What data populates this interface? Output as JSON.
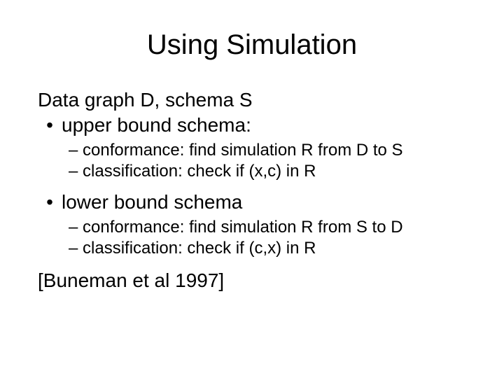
{
  "title": "Using Simulation",
  "intro": "Data graph D, schema S",
  "bullets": {
    "b1_glyph": "•",
    "b2_glyph": "–",
    "items": [
      {
        "label": "upper bound schema:",
        "sub": [
          "conformance: find simulation R from D to S",
          "classification: check if (x,c) in R"
        ]
      },
      {
        "label": "lower bound schema",
        "sub": [
          "conformance: find simulation R from S to D",
          "classification: check if (c,x) in R"
        ]
      }
    ]
  },
  "citation": "[Buneman et al 1997]"
}
